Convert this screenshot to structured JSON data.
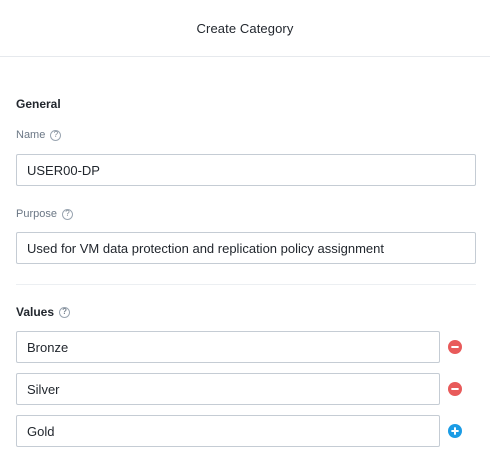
{
  "dialog": {
    "title": "Create Category"
  },
  "general": {
    "section_title": "General",
    "name": {
      "label": "Name",
      "value": "USER00-DP"
    },
    "purpose": {
      "label": "Purpose",
      "value": "Used for VM data protection and replication policy assignment"
    }
  },
  "values": {
    "section_title": "Values",
    "items": [
      {
        "value": "Bronze",
        "action": "remove"
      },
      {
        "value": "Silver",
        "action": "remove"
      },
      {
        "value": "Gold",
        "action": "add"
      }
    ]
  },
  "icons": {
    "help": "help-circle-icon",
    "remove": "minus-circle-icon",
    "add": "plus-circle-icon"
  },
  "colors": {
    "remove": "#e85a5a",
    "add": "#1b9ce5",
    "input_border": "#c5ccd4",
    "label": "#6b7785"
  }
}
